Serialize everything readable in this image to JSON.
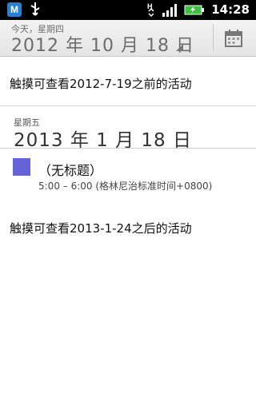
{
  "statusbar": {
    "time": "14:28",
    "icons": [
      "app-notification-icon",
      "usb-icon",
      "data-transfer-icon",
      "signal-icon",
      "battery-icon"
    ]
  },
  "header": {
    "subtitle": "今天，星期四",
    "date": "2012 年 10 月 18 日",
    "calendar_icon": "calendar-icon"
  },
  "links": {
    "before": "触摸可查看2012-7-19之前的活动",
    "after": "触摸可查看2013-1-24之后的活动"
  },
  "day": {
    "weekday": "星期五",
    "date": "2013 年 1 月 18 日"
  },
  "event": {
    "title": "（无标题）",
    "time": "5:00 – 6:00 (格林尼治标准时间+0800)",
    "color": "#6464d8"
  }
}
